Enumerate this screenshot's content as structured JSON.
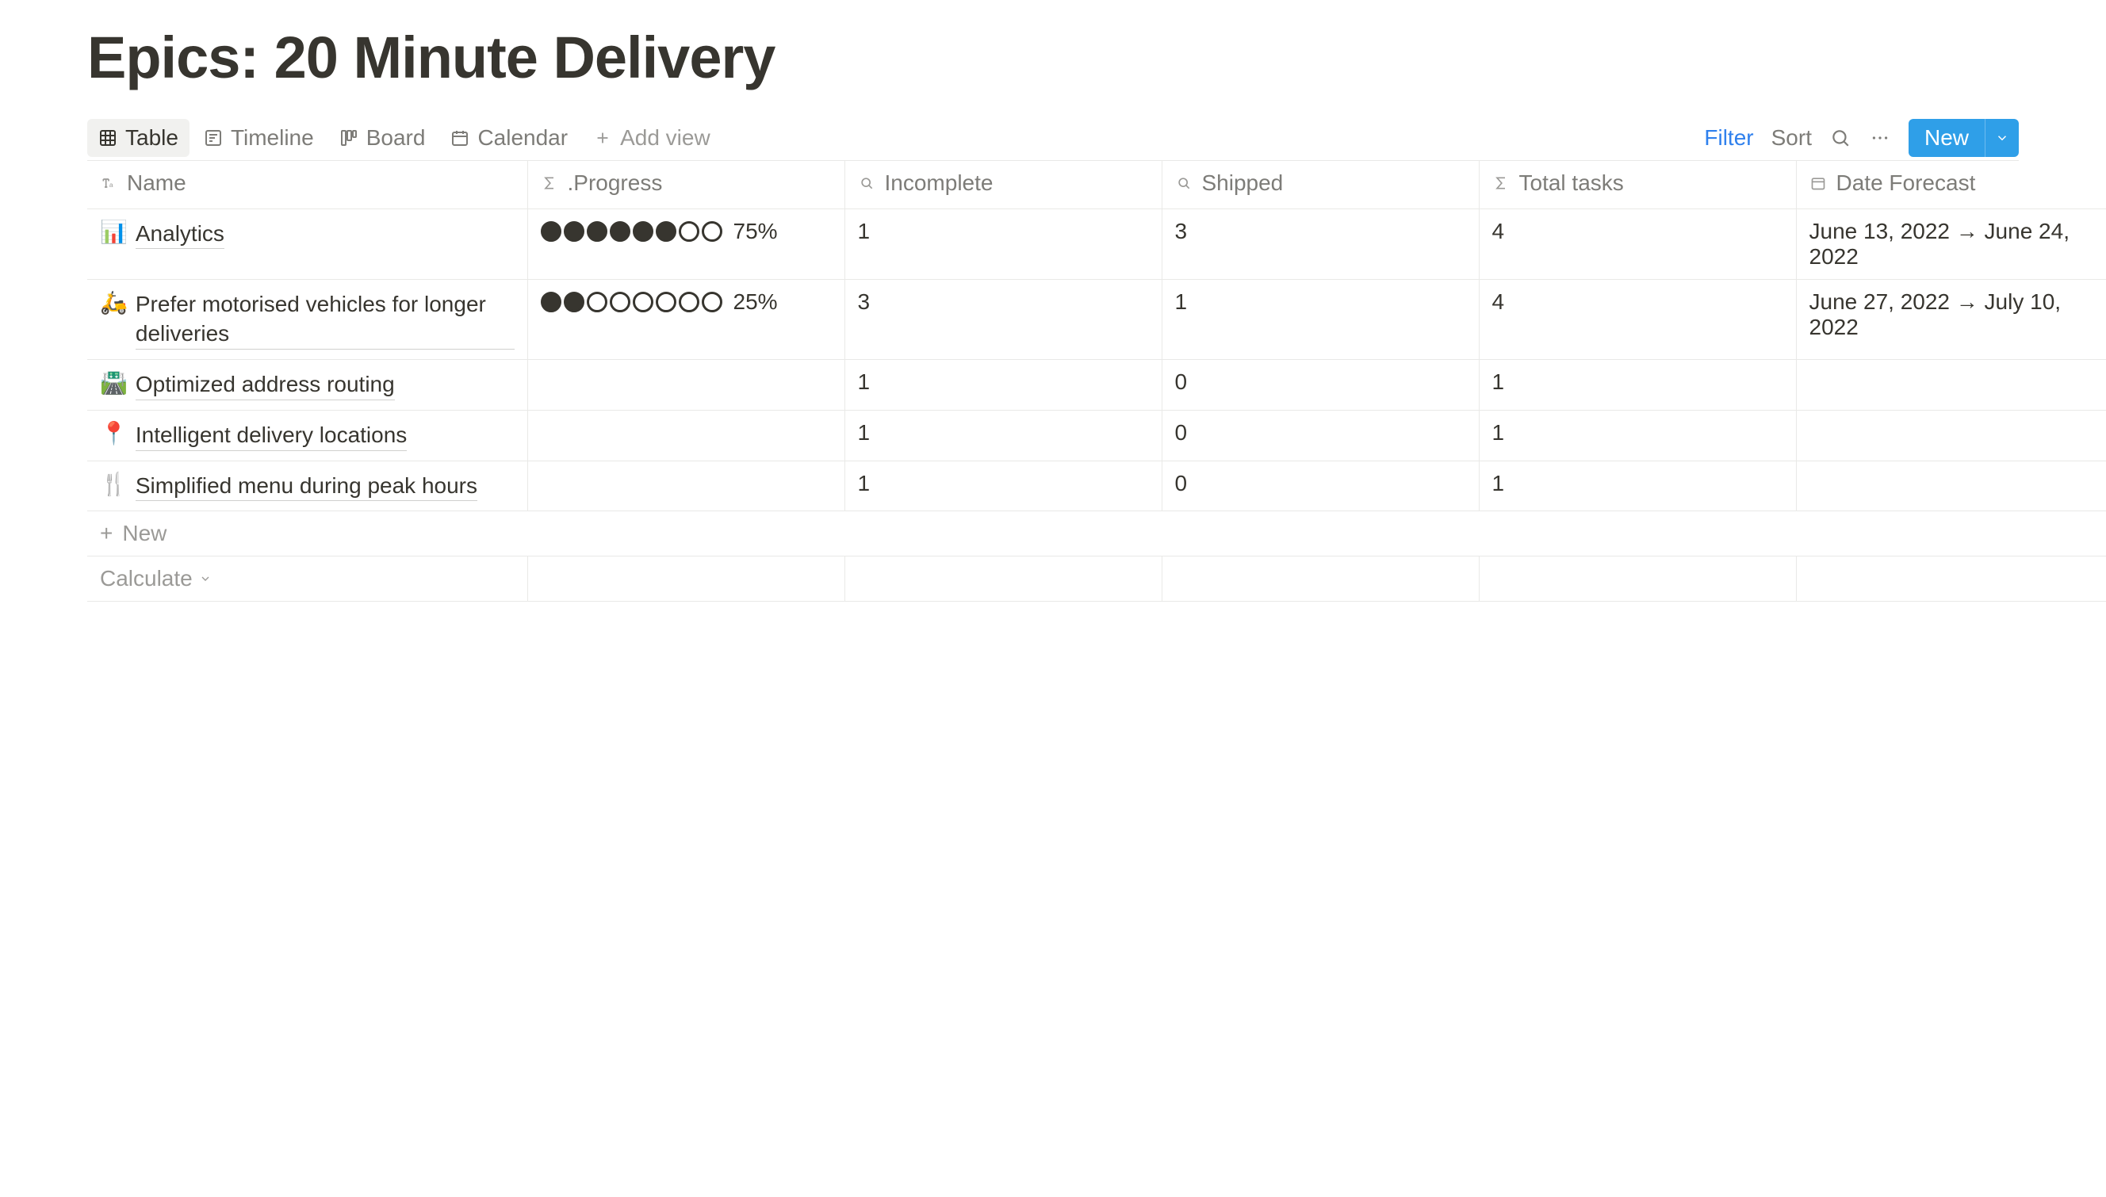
{
  "title": "Epics: 20 Minute Delivery",
  "views": {
    "table": "Table",
    "timeline": "Timeline",
    "board": "Board",
    "calendar": "Calendar",
    "add_view": "Add view"
  },
  "controls": {
    "filter": "Filter",
    "sort": "Sort",
    "new": "New"
  },
  "columns": {
    "name": "Name",
    "progress": ".Progress",
    "incomplete": "Incomplete",
    "shipped": "Shipped",
    "total": "Total tasks",
    "date": "Date Forecast"
  },
  "rows": [
    {
      "emoji": "📊",
      "name": "Analytics",
      "progress_pct": "75%",
      "progress_filled": 6,
      "progress_total": 8,
      "has_progress": true,
      "incomplete": "1",
      "shipped": "3",
      "total": "4",
      "date": "June 13, 2022 → June 24, 2022"
    },
    {
      "emoji": "🛵",
      "name": "Prefer motorised vehicles for longer deliveries",
      "progress_pct": "25%",
      "progress_filled": 2,
      "progress_total": 8,
      "has_progress": true,
      "incomplete": "3",
      "shipped": "1",
      "total": "4",
      "date": "June 27, 2022 → July 10, 2022"
    },
    {
      "emoji": "🛣️",
      "name": "Optimized address routing",
      "has_progress": false,
      "incomplete": "1",
      "shipped": "0",
      "total": "1",
      "date": ""
    },
    {
      "emoji": "📍",
      "name": "Intelligent delivery locations",
      "has_progress": false,
      "incomplete": "1",
      "shipped": "0",
      "total": "1",
      "date": ""
    },
    {
      "emoji": "🍴",
      "name": "Simplified menu during peak hours",
      "has_progress": false,
      "incomplete": "1",
      "shipped": "0",
      "total": "1",
      "date": ""
    }
  ],
  "new_row": "New",
  "calculate": "Calculate"
}
